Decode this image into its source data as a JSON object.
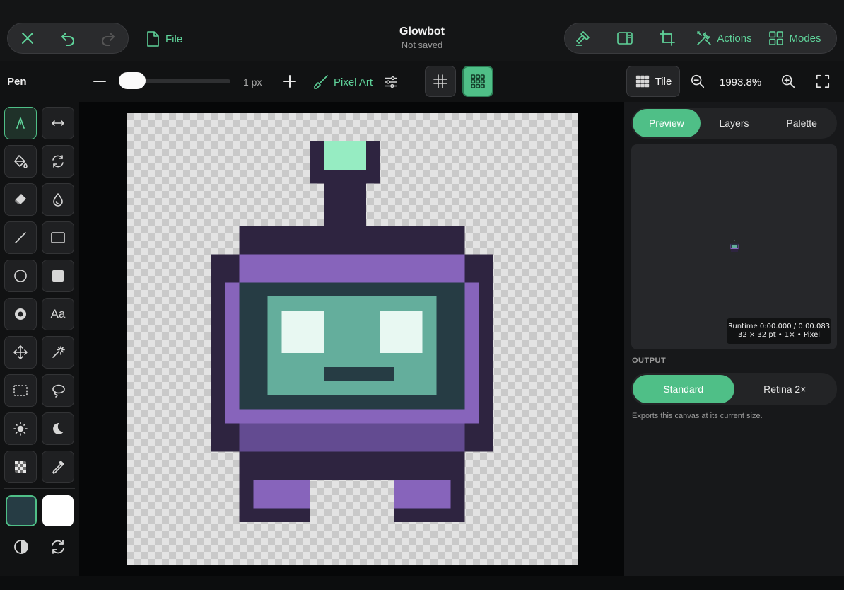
{
  "header": {
    "title": "Glowbot",
    "status": "Not saved",
    "file_label": "File",
    "actions_label": "Actions",
    "modes_label": "Modes"
  },
  "options": {
    "tool_name": "Pen",
    "brush_size": "1 px",
    "brush_size_fraction": 0.0,
    "brush_mode_label": "Pixel Art",
    "tile_label": "Tile",
    "zoom": "1993.8%",
    "pixel_grid_on": false,
    "tile_grid_on": true
  },
  "tools": [
    {
      "name": "pen",
      "icon": "pen-nib-icon",
      "active": true
    },
    {
      "name": "flip",
      "icon": "horizontal-arrows-icon"
    },
    {
      "name": "fill",
      "icon": "paint-bucket-icon"
    },
    {
      "name": "rotate",
      "icon": "rotate-icon"
    },
    {
      "name": "eraser",
      "icon": "eraser-icon"
    },
    {
      "name": "blur",
      "icon": "droplet-icon"
    },
    {
      "name": "line",
      "icon": "line-icon"
    },
    {
      "name": "rectangle",
      "icon": "rectangle-outline-icon"
    },
    {
      "name": "ellipse",
      "icon": "circle-outline-icon"
    },
    {
      "name": "filled-rectangle",
      "icon": "square-filled-icon"
    },
    {
      "name": "filled-ellipse",
      "icon": "circle-filled-icon"
    },
    {
      "name": "text",
      "icon": "text-icon",
      "label": "Aa"
    },
    {
      "name": "move",
      "icon": "move-arrows-icon"
    },
    {
      "name": "magic-wand",
      "icon": "magic-wand-icon"
    },
    {
      "name": "rect-select",
      "icon": "dashed-rectangle-icon"
    },
    {
      "name": "lasso",
      "icon": "lasso-icon"
    },
    {
      "name": "lighten",
      "icon": "sun-icon"
    },
    {
      "name": "darken",
      "icon": "moon-icon"
    },
    {
      "name": "dither",
      "icon": "checker-icon"
    },
    {
      "name": "eyedropper",
      "icon": "eyedropper-icon"
    }
  ],
  "colors": {
    "accent": "#4fbf87",
    "primary_swatch": "#263c44",
    "secondary_swatch": "#ffffff"
  },
  "panel": {
    "tabs": [
      "Preview",
      "Layers",
      "Palette"
    ],
    "active_tab": "Preview",
    "runtime_line": "Runtime 0:00.000 / 0:00.083",
    "canvas_info": "32 × 32 pt • 1× • Pixel",
    "output_heading": "OUTPUT",
    "output_options": [
      "Standard",
      "Retina 2×"
    ],
    "output_selected": "Standard",
    "output_note": "Exports this canvas at its current size."
  }
}
